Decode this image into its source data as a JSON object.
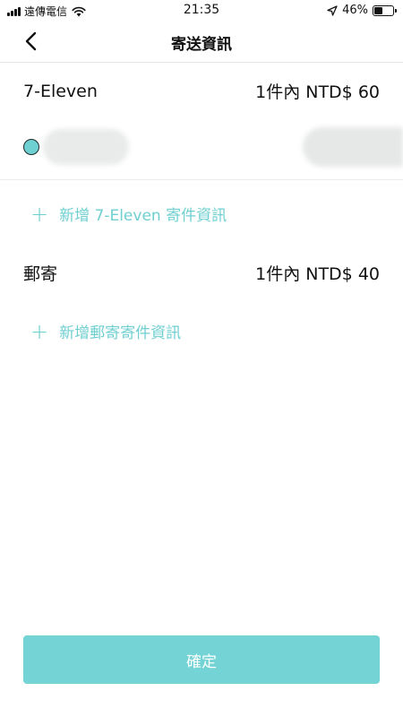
{
  "status_bar": {
    "carrier": "遠傳電信",
    "time": "21:35",
    "battery_text": "46%",
    "battery_level": 0.46,
    "signal_icon": "signal-bars-icon",
    "wifi_icon": "wifi-icon",
    "location_icon": "location-arrow-icon"
  },
  "nav": {
    "title": "寄送資訊",
    "back_icon": "chevron-left-icon"
  },
  "shipping": {
    "seven_eleven": {
      "name": "7-Eleven",
      "price": "1件內 NTD$ 60",
      "add_label": "新增 7-Eleven 寄件資訊"
    },
    "post": {
      "name": "郵寄",
      "price": "1件內 NTD$ 40",
      "add_label": "新增郵寄寄件資訊"
    },
    "plus_symbol": "+"
  },
  "footer": {
    "confirm_label": "確定"
  },
  "colors": {
    "accent": "#6fcfd0",
    "button": "#74d3d4"
  }
}
